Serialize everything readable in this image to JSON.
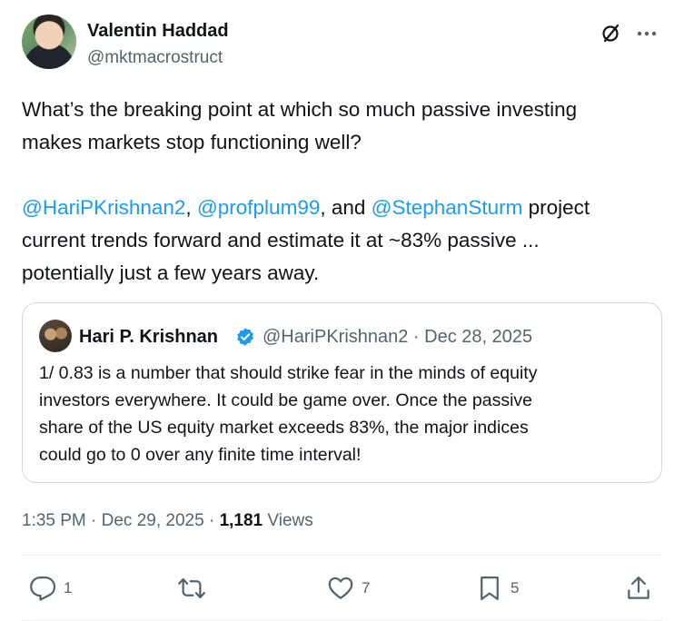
{
  "author": {
    "display_name": "Valentin Haddad",
    "handle": "@mktmacrostruct"
  },
  "tweet": {
    "line1": "What’s the breaking point at which so much passive investing",
    "line2": "makes markets stop functioning well?",
    "mention1": "@HariPKrishnan2",
    "sep1": ", ",
    "mention2": "@profplum99",
    "sep2": ", and ",
    "mention3": "@StephanSturm",
    "after_mentions": " project",
    "line4": "current trends forward and estimate it at ~83% passive ...",
    "line5": "potentially just a few years away."
  },
  "quote": {
    "display_name": "Hari P. Krishnan",
    "meta": "@HariPKrishnan2 · Dec 28, 2025",
    "line1": "1/ 0.83 is a number that should strike fear in the minds of equity",
    "line2": "investors everywhere. It could be game over. Once the passive",
    "line3": "share of the US equity market exceeds 83%, the major indices",
    "line4": "could go to 0 over any finite time interval!"
  },
  "meta": {
    "time_date": "1:35 PM · Dec 29, 2025 · ",
    "views_count": "1,181",
    "views_label": " Views"
  },
  "actions": {
    "replies": "1",
    "reposts": "",
    "likes": "7",
    "bookmarks": "5"
  },
  "icons": {
    "grok": "grok-icon",
    "more": "more-icon",
    "verified": "verified-badge-icon",
    "reply": "reply-icon",
    "repost": "repost-icon",
    "like": "heart-icon",
    "bookmark": "bookmark-icon",
    "share": "share-icon"
  },
  "colors": {
    "accent": "#1d9bf0",
    "text": "#0f1419",
    "secondary": "#536471",
    "border": "#cfd9de"
  }
}
